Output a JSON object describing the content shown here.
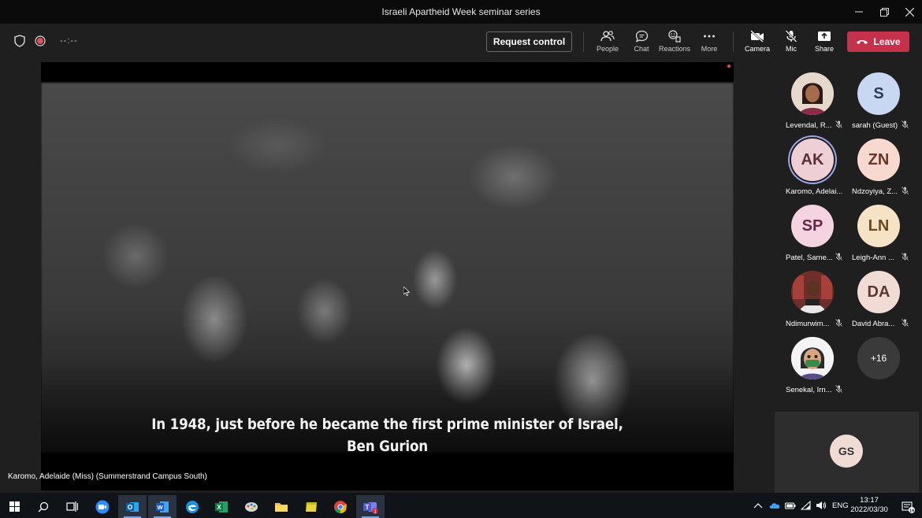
{
  "window": {
    "title": "Israeli Apartheid Week seminar series"
  },
  "toolbar": {
    "timer": "--:--",
    "request_control": "Request control",
    "people": "People",
    "chat": "Chat",
    "reactions": "Reactions",
    "more": "More",
    "camera": "Camera",
    "mic": "Mic",
    "share": "Share",
    "leave": "Leave"
  },
  "video": {
    "subtitle_line1": "In 1948, just before he became the first prime minister of Israel,",
    "subtitle_line2": "Ben Gurion",
    "presenter_label": "Karomo, Adelaide (Miss) (Summerstrand Campus South)"
  },
  "participants": [
    {
      "name": "Levendal, R...",
      "initials": "",
      "photo": true,
      "color": "#c07a5a",
      "muted": true
    },
    {
      "name": "sarah (Guest)",
      "initials": "S",
      "color": "#c9d8f2",
      "muted": true
    },
    {
      "name": "Karomo, Adelai...",
      "initials": "AK",
      "color": "#efcfd6",
      "muted": false,
      "active": true
    },
    {
      "name": "Ndzoyiya, Z...",
      "initials": "ZN",
      "color": "#f7d9cf",
      "muted": true
    },
    {
      "name": "Patel, Same...",
      "initials": "SP",
      "color": "#f5d3e0",
      "muted": true
    },
    {
      "name": "Leigh-Ann ...",
      "initials": "LN",
      "color": "#f6e3c6",
      "muted": true
    },
    {
      "name": "Ndimurwim...",
      "initials": "",
      "photo": true,
      "color": "#7a3b34",
      "muted": true
    },
    {
      "name": "David Abra...",
      "initials": "DA",
      "color": "#f1dcd5",
      "muted": true
    },
    {
      "name": "Senekal, Irn...",
      "initials": "",
      "photo": true,
      "color": "#e8e8e8",
      "muted": true
    }
  ],
  "overflow_count": "+16",
  "self_tile": {
    "initials": "GS"
  },
  "taskbar": {
    "language": "ENG",
    "time": "13:17",
    "date": "2022/03/30",
    "notifications": "19",
    "teams_badge": "1"
  },
  "colors": {
    "leave": "#c4314b",
    "active_ring": "#9aa6e8",
    "taskbar": "#101317"
  }
}
